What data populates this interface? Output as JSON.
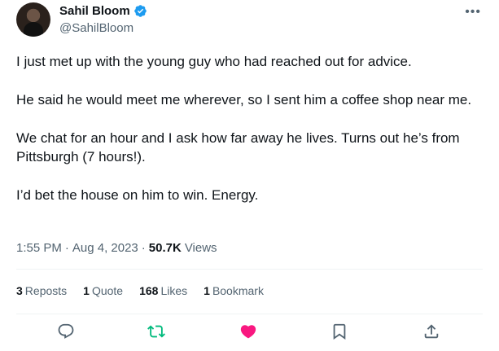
{
  "author": {
    "name": "Sahil Bloom",
    "handle": "@SahilBloom",
    "verified": true
  },
  "tweet": {
    "paragraphs": [
      "I just met up with the young guy who had reached out for advice.",
      "He said he would meet me wherever, so I sent him a coffee shop near me.",
      "We chat for an hour and I ask how far away he lives. Turns out he’s from Pittsburgh (7 hours!).",
      "I’d bet the house on him to win. Energy."
    ]
  },
  "meta": {
    "time": "1:55 PM",
    "separator": "·",
    "date": "Aug 4, 2023",
    "views_count": "50.7K",
    "views_label": "Views"
  },
  "stats": {
    "reposts": {
      "count": "3",
      "label": "Reposts"
    },
    "quotes": {
      "count": "1",
      "label": "Quote"
    },
    "likes": {
      "count": "168",
      "label": "Likes"
    },
    "bookmarks": {
      "count": "1",
      "label": "Bookmark"
    }
  },
  "more_label": "•••",
  "colors": {
    "verified": "#1d9bf0",
    "reply": "#536471",
    "repost_active": "#00ba7c",
    "like_active": "#f91880",
    "bookmark": "#536471",
    "share": "#536471"
  },
  "icons": {
    "verified": "verified-badge-icon",
    "reply": "reply-icon",
    "repost": "repost-icon",
    "like": "heart-icon",
    "bookmark": "bookmark-icon",
    "share": "share-icon"
  }
}
